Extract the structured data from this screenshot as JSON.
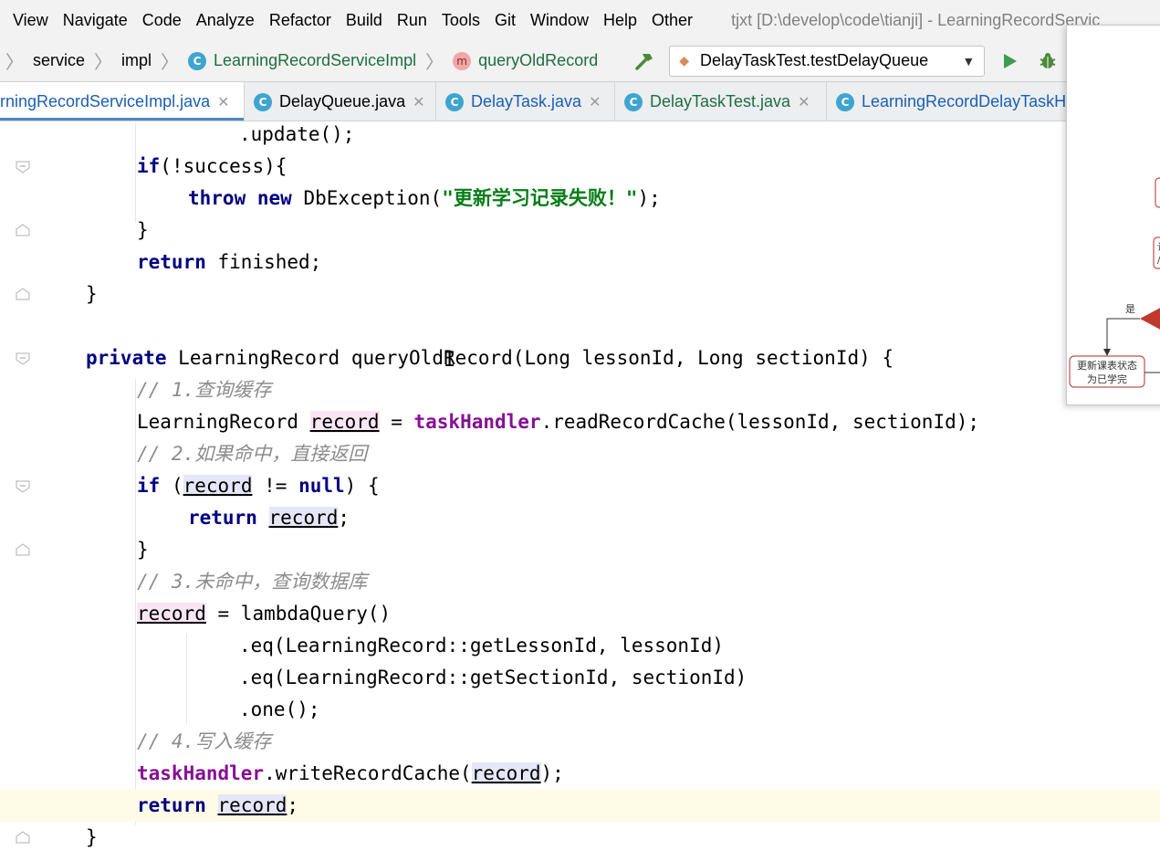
{
  "menu": {
    "items": [
      "View",
      "Navigate",
      "Code",
      "Analyze",
      "Refactor",
      "Build",
      "Run",
      "Tools",
      "Git",
      "Window",
      "Help",
      "Other"
    ],
    "window_title": "tjxt [D:\\develop\\code\\tianji] - LearningRecordServic"
  },
  "breadcrumb": {
    "items": [
      "service",
      "impl"
    ],
    "class_name": "LearningRecordServiceImpl",
    "method_name": "queryOldRecord"
  },
  "run_config": {
    "label": "DelayTaskTest.testDelayQueue"
  },
  "tabs": [
    {
      "label": "rningRecordServiceImpl.java"
    },
    {
      "label": "DelayQueue.java"
    },
    {
      "label": "DelayTask.java"
    },
    {
      "label": "DelayTaskTest.java"
    },
    {
      "label": "LearningRecordDelayTaskH"
    }
  ],
  "code": {
    "update": ".update();",
    "if_kw": "if",
    "if_cond": "(!success){",
    "throw_kw": "throw",
    "new_kw": "new",
    "db_exc": "DbException(",
    "db_exc_msg": "\"更新学习记录失败！\"",
    "db_exc_end": ");",
    "brace_close": "}",
    "return_kw": "return",
    "finished": "finished;",
    "private_kw": "private",
    "method_sig": "LearningRecord queryOldRecord(Long lessonId, Long sectionId) {",
    "c1": "// 1.查询缓存",
    "l_type": "LearningRecord",
    "record": "record",
    "eq": "=",
    "task_handler": "taskHandler",
    "read_cache": ".readRecordCache(lessonId, sectionId);",
    "c2": "// 2.如果命中，直接返回",
    "if_open": "(",
    "not_null": "!=",
    "null_kw": "null",
    "if_close": ") {",
    "semicolon": ";",
    "c3": "// 3.未命中，查询数据库",
    "lambda": "= lambdaQuery()",
    "eq1": ".eq(LearningRecord::getLessonId, lessonId)",
    "eq2": ".eq(LearningRecord::getSectionId, sectionId)",
    "one": ".one();",
    "c4": "// 4.写入缓存",
    "write_cache": ".writeRecordCache(",
    "write_end": ");"
  },
  "diagram": {
    "yes_label": "是",
    "box_label_line1": "更新课表状态",
    "box_label_line2": "为已学完",
    "partial_line1": "让",
    "partial_line2": "/"
  }
}
